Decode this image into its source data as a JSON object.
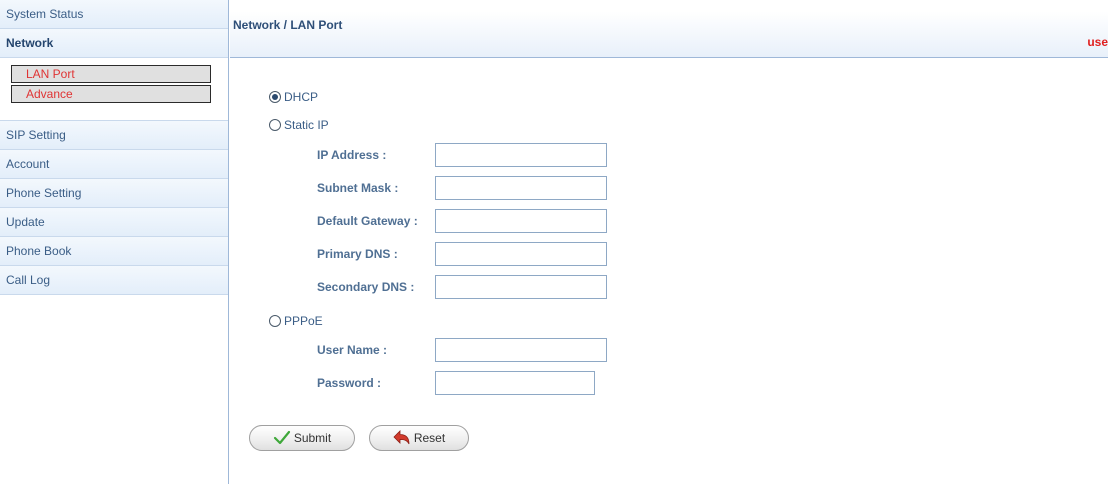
{
  "sidebar": {
    "items": [
      {
        "label": "System Status"
      },
      {
        "label": "Network"
      },
      {
        "label": "SIP Setting"
      },
      {
        "label": "Account"
      },
      {
        "label": "Phone Setting"
      },
      {
        "label": "Update"
      },
      {
        "label": "Phone Book"
      },
      {
        "label": "Call Log"
      }
    ],
    "network_sub": [
      {
        "label": "LAN Port"
      },
      {
        "label": "Advance"
      }
    ]
  },
  "header": {
    "breadcrumb": "Network / LAN Port",
    "user_text": "use"
  },
  "form": {
    "dhcp_label": "DHCP",
    "static_label": "Static IP",
    "pppoe_label": "PPPoE",
    "selected_mode": "DHCP",
    "static_fields": [
      {
        "label": "IP Address :",
        "value": ""
      },
      {
        "label": "Subnet Mask :",
        "value": ""
      },
      {
        "label": "Default Gateway :",
        "value": ""
      },
      {
        "label": "Primary DNS :",
        "value": ""
      },
      {
        "label": "Secondary DNS :",
        "value": ""
      }
    ],
    "pppoe_fields": [
      {
        "label": "User Name :",
        "value": ""
      },
      {
        "label": "Password :",
        "value": ""
      }
    ]
  },
  "buttons": {
    "submit_label": "Submit",
    "reset_label": "Reset"
  },
  "colors": {
    "accent_text": "#3a5d86",
    "submenu_text": "#e03434",
    "user_text": "#e02020"
  },
  "icons": {
    "submit": "checkmark-icon",
    "reset": "undo-arrow-icon"
  }
}
